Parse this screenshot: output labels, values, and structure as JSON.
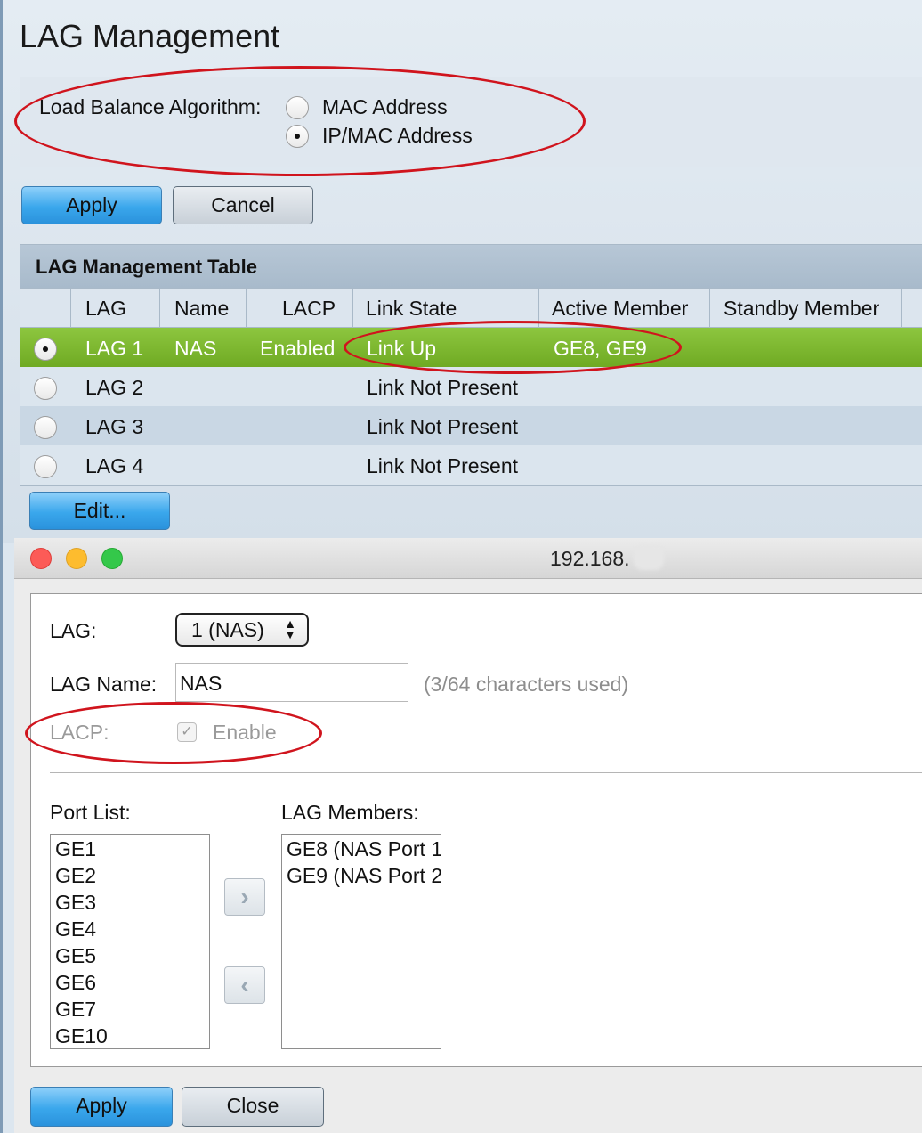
{
  "page": {
    "title": "LAG Management",
    "load_balance_label": "Load Balance Algorithm:",
    "options": [
      {
        "label": "MAC Address",
        "checked": false
      },
      {
        "label": "IP/MAC Address",
        "checked": true
      }
    ],
    "apply_label": "Apply",
    "cancel_label": "Cancel"
  },
  "table": {
    "title": "LAG Management Table",
    "columns": [
      "LAG",
      "Name",
      "LACP",
      "Link State",
      "Active Member",
      "Standby Member"
    ],
    "rows": [
      {
        "lag": "LAG 1",
        "name": "NAS",
        "lacp": "Enabled",
        "link_state": "Link Up",
        "active": "GE8, GE9",
        "standby": "",
        "selected": true
      },
      {
        "lag": "LAG 2",
        "name": "",
        "lacp": "",
        "link_state": "Link Not Present",
        "active": "",
        "standby": "",
        "selected": false
      },
      {
        "lag": "LAG 3",
        "name": "",
        "lacp": "",
        "link_state": "Link Not Present",
        "active": "",
        "standby": "",
        "selected": false
      },
      {
        "lag": "LAG 4",
        "name": "",
        "lacp": "",
        "link_state": "Link Not Present",
        "active": "",
        "standby": "",
        "selected": false
      }
    ],
    "edit_label": "Edit..."
  },
  "popup": {
    "window_title": "192.168.",
    "lag_label": "LAG:",
    "lag_value": "1 (NAS)",
    "lag_name_label": "LAG Name:",
    "lag_name_value": "NAS",
    "chars_hint": "(3/64 characters used)",
    "lacp_label": "LACP:",
    "lacp_enable_label": "Enable",
    "lacp_checked": true,
    "port_list_label": "Port List:",
    "port_list": [
      "GE1",
      "GE2",
      "GE3",
      "GE4",
      "GE5",
      "GE6",
      "GE7",
      "GE10"
    ],
    "lag_members_label": "LAG Members:",
    "lag_members": [
      "GE8 (NAS Port 1",
      "GE9 (NAS Port 2"
    ],
    "apply_label": "Apply",
    "close_label": "Close"
  },
  "colors": {
    "selected_row": "#7ab52e",
    "annotation": "#d0141d",
    "button_blue": "#3aa7ec"
  },
  "icons": {
    "add_arrow": "chevron-right-icon",
    "remove_arrow": "chevron-left-icon"
  }
}
